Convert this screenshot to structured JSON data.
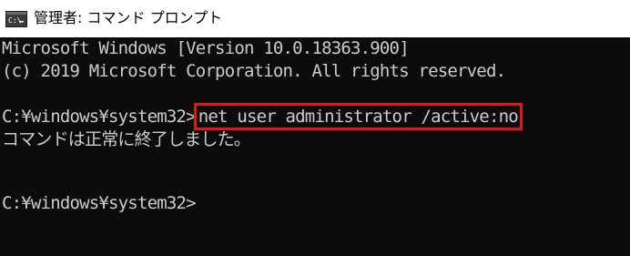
{
  "window": {
    "title": "管理者: コマンド プロンプト",
    "icon": "cmd-icon"
  },
  "console": {
    "lines": [
      "Microsoft Windows [Version 10.0.18363.900]",
      "(c) 2019 Microsoft Corporation. All rights reserved."
    ],
    "prompt1": "C:¥windows¥system32>",
    "command": "net user administrator /active:no",
    "result": "コマンドは正常に終了しました。",
    "prompt2": "C:¥windows¥system32>"
  },
  "colors": {
    "background": "#0c0c0c",
    "text": "#cccccc",
    "highlight": "#e21616",
    "titlebar": "#ffffff"
  }
}
